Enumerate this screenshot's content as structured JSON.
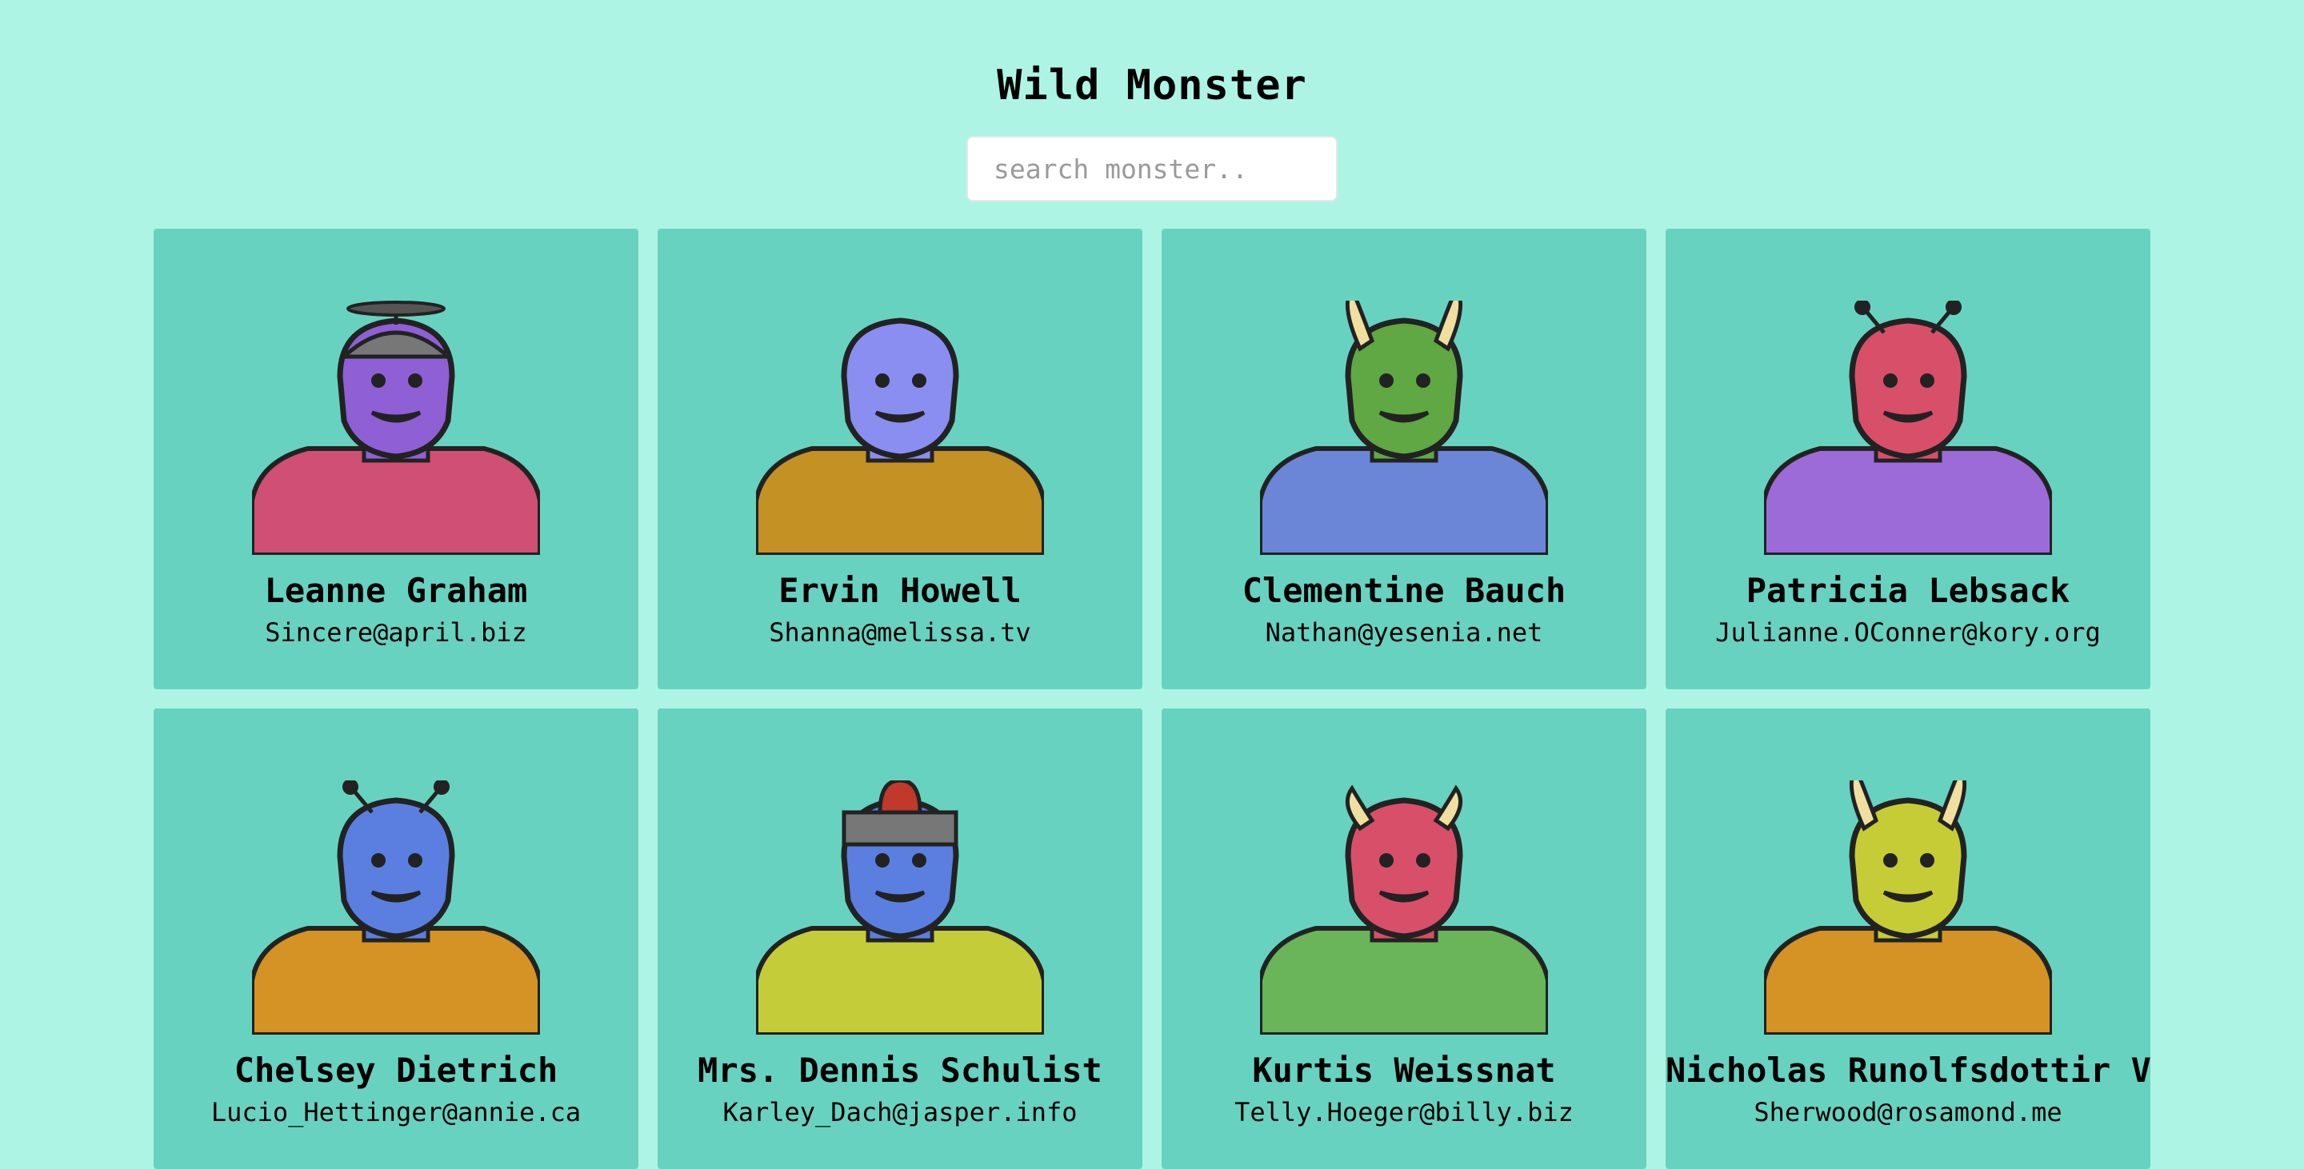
{
  "header": {
    "title": "Wild Monster"
  },
  "search": {
    "placeholder": "search monster..",
    "value": ""
  },
  "monsters": [
    {
      "name": "Leanne Graham",
      "email": "Sincere@april.biz",
      "head_color": "#8f5fd6",
      "body_color": "#d04f74",
      "accessory": "propeller-helmet"
    },
    {
      "name": "Ervin Howell",
      "email": "Shanna@melissa.tv",
      "head_color": "#8a8ef0",
      "body_color": "#c39124",
      "accessory": "none"
    },
    {
      "name": "Clementine Bauch",
      "email": "Nathan@yesenia.net",
      "head_color": "#5fa843",
      "body_color": "#6b86d6",
      "accessory": "horns"
    },
    {
      "name": "Patricia Lebsack",
      "email": "Julianne.OConner@kory.org",
      "head_color": "#d84f6a",
      "body_color": "#9d6bd8",
      "accessory": "antennae"
    },
    {
      "name": "Chelsey Dietrich",
      "email": "Lucio_Hettinger@annie.ca",
      "head_color": "#5b7fe0",
      "body_color": "#d49324",
      "accessory": "antennae"
    },
    {
      "name": "Mrs. Dennis Schulist",
      "email": "Karley_Dach@jasper.info",
      "head_color": "#5b7fe0",
      "body_color": "#c4cc3a",
      "accessory": "siren-helmet"
    },
    {
      "name": "Kurtis Weissnat",
      "email": "Telly.Hoeger@billy.biz",
      "head_color": "#d84f6a",
      "body_color": "#6ab45a",
      "accessory": "small-horns"
    },
    {
      "name": "Nicholas Runolfsdottir V",
      "email": "Sherwood@rosamond.me",
      "head_color": "#c6cc35",
      "body_color": "#d49324",
      "accessory": "horns"
    }
  ]
}
